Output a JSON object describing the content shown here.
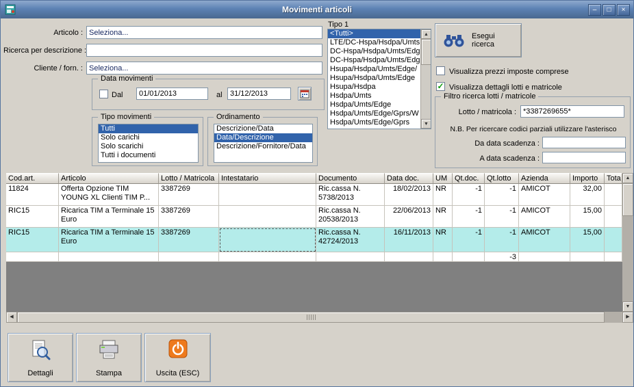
{
  "window": {
    "title": "Movimenti articoli",
    "controls": {
      "minimize": "–",
      "maximize": "□",
      "close": "×"
    }
  },
  "icons": {
    "arrow_up": "▲",
    "arrow_down": "▼",
    "arrow_left": "◀",
    "arrow_right": "▶"
  },
  "colors": {
    "selection": "#3163ab",
    "row_highlight": "#b4ecea",
    "titlebar": "#5d82b4",
    "check_green": "#0c9c0c"
  },
  "form": {
    "articolo": {
      "label": "Articolo :",
      "value": "Seleziona..."
    },
    "ricerca_descrizione": {
      "label": "Ricerca per descrizione :",
      "value": ""
    },
    "cliente": {
      "label": "Cliente / forn. :",
      "value": "Seleziona..."
    },
    "data_movimenti": {
      "title": "Data movimenti",
      "dal_label": "Dal",
      "dal_value": "01/01/2013",
      "al_label": "al",
      "al_value": "31/12/2013"
    },
    "tipo_movimenti": {
      "title": "Tipo movimenti",
      "items": [
        "Tutti",
        "Solo carichi",
        "Solo scarichi",
        "Tutti i documenti"
      ],
      "selected": "Tutti"
    },
    "ordinamento": {
      "title": "Ordinamento",
      "items": [
        "Descrizione/Data",
        "Data/Descrizione",
        "Descrizione/Fornitore/Data"
      ],
      "selected": "Data/Descrizione"
    },
    "tipo1": {
      "label": "Tipo 1",
      "items": [
        "<Tutti>",
        "LTE/DC-Hspa/Hsdpa/Umts",
        "DC-Hspa/Hsdpa/Umts/Edg",
        "DC-Hspa/Hsdpa/Umts/Edg",
        "Hsupa/Hsdpa/Umts/Edge/",
        "Hsupa/Hsdpa/Umts/Edge",
        "Hsupa/Hsdpa",
        "Hsdpa/Umts",
        "Hsdpa/Umts/Edge",
        "Hsdpa/Umts/Edge/Gprs/W",
        "Hsdpa/Umts/Edge/Gprs"
      ],
      "selected": "<Tutti>"
    },
    "esegui_ricerca_label": "Esegui ricerca",
    "check_prezzi": {
      "label": "Visualizza prezzi imposte comprese",
      "checked": false
    },
    "check_lotti": {
      "label": "Visualizza dettagli lotti e matricole",
      "checked": true,
      "checkmark": "✓"
    },
    "filtro": {
      "title": "Filtro ricerca lotti / matricole",
      "lotto_label": "Lotto / matricola :",
      "lotto_value": "*3387269655*",
      "nota": "N.B. Per ricercare codici parziali utilizzare l'asterisco",
      "da_label": "Da data scadenza :",
      "da_value": "",
      "a_label": "A data scadenza :",
      "a_value": ""
    }
  },
  "table": {
    "columns": [
      "Cod.art.",
      "Articolo",
      "Lotto / Matricola",
      "Intestatario",
      "Documento",
      "Data doc.",
      "UM",
      "Qt.doc.",
      "Qt.lotto",
      "Azienda",
      "Importo",
      "Tota"
    ],
    "rows": [
      {
        "cod": "11824",
        "articolo": "Offerta Opzione TIM YOUNG XL Clienti TIM P...",
        "lotto": "3387269",
        "intestatario": "",
        "documento": "Ric.cassa N. 5738/2013",
        "data_doc": "18/02/2013",
        "um": "NR",
        "qt_doc": "-1",
        "qt_lotto": "-1",
        "azienda": "AMICOT",
        "importo": "32,00"
      },
      {
        "cod": "RIC15",
        "articolo": "Ricarica TIM a Terminale 15 Euro",
        "lotto": "3387269",
        "intestatario": "",
        "documento": "Ric.cassa N. 20538/2013",
        "data_doc": "22/06/2013",
        "um": "NR",
        "qt_doc": "-1",
        "qt_lotto": "-1",
        "azienda": "AMICOT",
        "importo": "15,00"
      },
      {
        "cod": "RIC15",
        "articolo": "Ricarica TIM a Terminale 15 Euro",
        "lotto": "3387269",
        "intestatario": "",
        "documento": "Ric.cassa N. 42724/2013",
        "data_doc": "16/11/2013",
        "um": "NR",
        "qt_doc": "-1",
        "qt_lotto": "-1",
        "azienda": "AMICOT",
        "importo": "15,00"
      }
    ],
    "totals": {
      "qt_lotto": "-3"
    }
  },
  "footer": {
    "dettagli": "Dettagli",
    "stampa": "Stampa",
    "uscita": "Uscita (ESC)"
  }
}
